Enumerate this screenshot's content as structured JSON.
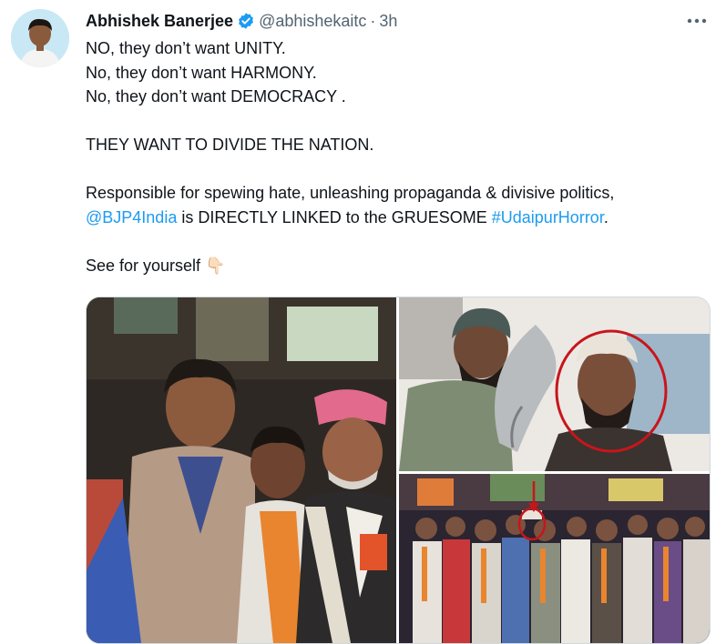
{
  "tweet": {
    "author_name": "Abhishek Banerjee",
    "handle": "@abhishekaitc",
    "separator": "·",
    "time": "3h",
    "lines": [
      "NO, they don’t want UNITY.",
      "No, they don’t want HARMONY.",
      "No, they don’t want DEMOCRACY .",
      "THEY WANT TO DIVIDE THE NATION.",
      "Responsible for spewing hate, unleashing propaganda & divisive politics,"
    ],
    "mention": "@BJP4India",
    "middle_text": " is DIRECTLY LINKED to the GRUESOME ",
    "hashtag": "#UdaipurHorror",
    "end_text": ".",
    "see_text": "See for yourself",
    "emoji": "👇🏻"
  },
  "icons": {
    "verified": "verified-badge-icon",
    "more": "more-options-icon"
  },
  "colors": {
    "link": "#1d9bf0",
    "secondary_text": "#536471",
    "verified": "#1d9bf0"
  }
}
